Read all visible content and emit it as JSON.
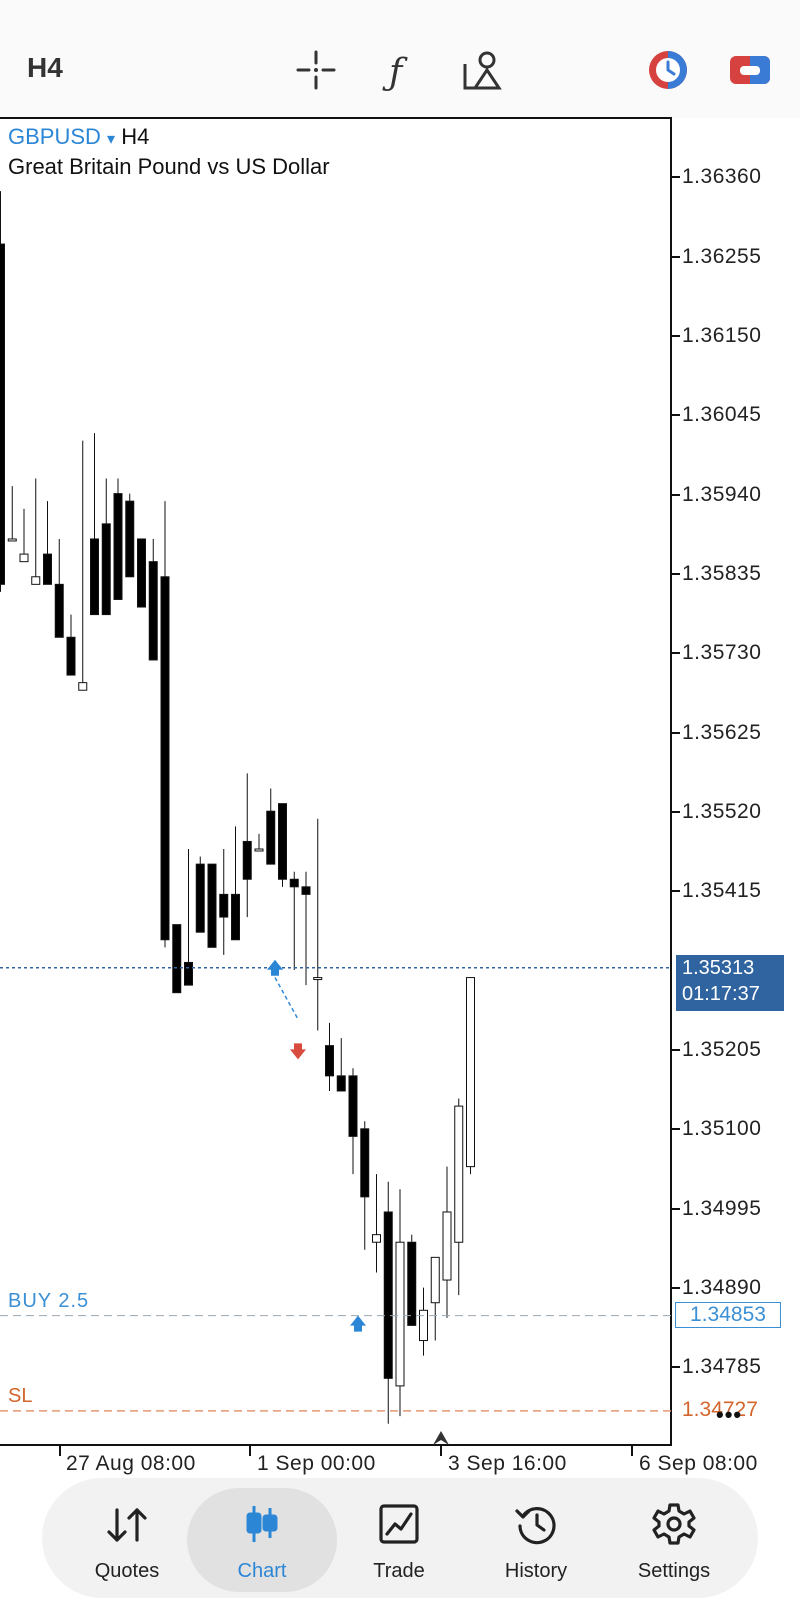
{
  "toolbar": {
    "timeframe": "H4",
    "icons": [
      "crosshair-icon",
      "indicators-icon",
      "objects-icon",
      "clock-icon",
      "toggle-icon"
    ]
  },
  "chart": {
    "symbol": "GBPUSD",
    "symbol_dropdown": "▾",
    "timeframe": "H4",
    "description": "Great Britain Pound vs US Dollar",
    "current_price": "1.35313",
    "countdown": "01:17:37",
    "buy_label": "BUY 2.5",
    "buy_price": "1.34853",
    "sl_label": "SL",
    "sl_price": "1.34727",
    "more": "•••",
    "price_axis": [
      "1.36360",
      "1.36255",
      "1.36150",
      "1.36045",
      "1.35940",
      "1.35835",
      "1.35730",
      "1.35625",
      "1.35520",
      "1.35415",
      "1.35205",
      "1.35100",
      "1.34995",
      "1.34890",
      "1.34785"
    ],
    "time_axis": [
      "27 Aug 08:00",
      "1 Sep 00:00",
      "3 Sep 16:00",
      "6 Sep 08:00"
    ],
    "colors": {
      "bull": "#ffffff",
      "bear": "#000000",
      "buy": "#2c86d6",
      "sell": "#d94a3f",
      "sl": "#d3652d",
      "bid_line": "#2f64a0"
    }
  },
  "chart_data": {
    "type": "candlestick",
    "candles": [
      [
        1.3627,
        1.3634,
        1.3582,
        1.3581
      ],
      [
        1.3588,
        1.3595,
        1.3588,
        1.3596
      ],
      [
        1.3585,
        1.3592,
        1.3586,
        1.3591
      ],
      [
        1.3582,
        1.3596,
        1.3583,
        1.3593
      ],
      [
        1.3586,
        1.3593,
        1.3582,
        1.3586
      ],
      [
        1.3582,
        1.3588,
        1.3575,
        1.3576
      ],
      [
        1.3575,
        1.3578,
        1.357,
        1.3571
      ],
      [
        1.3568,
        1.3601,
        1.3569,
        1.3575
      ],
      [
        1.3588,
        1.3602,
        1.3578,
        1.3589
      ],
      [
        1.359,
        1.3596,
        1.3578,
        1.359
      ],
      [
        1.3594,
        1.3596,
        1.358,
        1.3586
      ],
      [
        1.3593,
        1.3594,
        1.3583,
        1.359
      ],
      [
        1.3588,
        1.3588,
        1.3579,
        1.3586
      ],
      [
        1.3585,
        1.3588,
        1.3572,
        1.3578
      ],
      [
        1.3583,
        1.3593,
        1.3535,
        1.3534
      ],
      [
        1.3537,
        1.3537,
        1.3528,
        1.3532
      ],
      [
        1.3532,
        1.3547,
        1.3529,
        1.3545
      ],
      [
        1.3545,
        1.3546,
        1.3536,
        1.3544
      ],
      [
        1.3545,
        1.3544,
        1.3534,
        1.3539
      ],
      [
        1.3541,
        1.3547,
        1.3538,
        1.3533
      ],
      [
        1.3541,
        1.355,
        1.3535,
        1.3535
      ],
      [
        1.3548,
        1.3557,
        1.3543,
        1.3538
      ],
      [
        1.3547,
        1.3549,
        1.3547,
        1.3547
      ],
      [
        1.3552,
        1.3555,
        1.3545,
        1.3547
      ],
      [
        1.3553,
        1.3548,
        1.3543,
        1.3542
      ],
      [
        1.3543,
        1.3544,
        1.3542,
        1.3531
      ],
      [
        1.3542,
        1.3544,
        1.3541,
        1.3529
      ],
      [
        1.353,
        1.3551,
        1.353,
        1.3523
      ],
      [
        1.3521,
        1.3524,
        1.3517,
        1.3515
      ],
      [
        1.3517,
        1.3522,
        1.3515,
        1.3515
      ],
      [
        1.3517,
        1.3518,
        1.3509,
        1.3504
      ],
      [
        1.351,
        1.3511,
        1.3501,
        1.3494
      ],
      [
        1.3495,
        1.3504,
        1.3496,
        1.3491
      ],
      [
        1.3499,
        1.3503,
        1.3477,
        1.3471
      ],
      [
        1.3476,
        1.3502,
        1.3495,
        1.3472
      ],
      [
        1.3495,
        1.3496,
        1.3484,
        1.3484
      ],
      [
        1.3482,
        1.3489,
        1.3486,
        1.348
      ],
      [
        1.3487,
        1.349,
        1.3493,
        1.3482
      ],
      [
        1.349,
        1.3505,
        1.3499,
        1.3485
      ],
      [
        1.3495,
        1.3514,
        1.3513,
        1.3488
      ],
      [
        1.3505,
        1.3526,
        1.353,
        1.3504
      ]
    ],
    "ohlc_order": [
      "open",
      "high",
      "close",
      "low"
    ],
    "ylim": [
      1.3471,
      1.364
    ],
    "current_price": 1.35313,
    "buy_level": 1.34853,
    "sl_level": 1.34727
  },
  "nav": {
    "items": [
      {
        "label": "Quotes",
        "icon": "quotes-icon"
      },
      {
        "label": "Chart",
        "icon": "chart-icon"
      },
      {
        "label": "Trade",
        "icon": "trade-icon"
      },
      {
        "label": "History",
        "icon": "history-icon"
      },
      {
        "label": "Settings",
        "icon": "settings-icon"
      }
    ],
    "active": "Chart"
  }
}
